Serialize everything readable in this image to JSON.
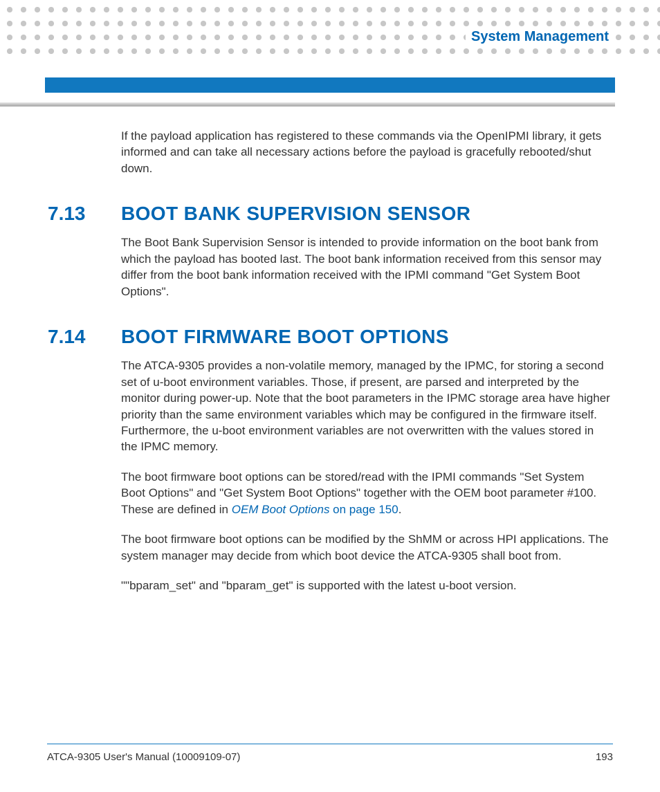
{
  "header": {
    "chapter": "System Management"
  },
  "intro_paragraph": "If the payload application has registered to these commands via the OpenIPMI library, it gets informed and can take all necessary actions before the payload is gracefully rebooted/shut down.",
  "section_713": {
    "number": "7.13",
    "title": "BOOT BANK SUPERVISION SENSOR",
    "p1": "The Boot Bank Supervision Sensor is intended to provide information on the boot bank from which the payload has booted last. The boot bank information received from this sensor may differ from the boot bank information received with the IPMI command \"Get System Boot Options\"."
  },
  "section_714": {
    "number": "7.14",
    "title": "BOOT FIRMWARE BOOT OPTIONS",
    "p1": "The ATCA-9305 provides a non-volatile memory, managed by the IPMC, for storing a second set of u-boot environment variables. Those, if present, are parsed and interpreted by the monitor during power-up. Note that the boot parameters in the IPMC storage area have higher priority than the same environment variables which may be configured in the firmware itself. Furthermore, the u-boot environment variables are not overwritten with the values stored in the IPMC memory.",
    "p2_pre": "The boot firmware boot options can be stored/read with the IPMI commands \"Set System Boot Options\" and \"Get System Boot Options\" together with the OEM boot parameter #100. These are defined in ",
    "p2_link": "OEM Boot Options",
    "p2_link_tail": " on page 150",
    "p2_post": ".",
    "p3": "The boot firmware boot options can be modified by the ShMM or across HPI applications. The system manager may decide from which boot device the ATCA-9305 shall boot from.",
    "p4": "\"\"bparam_set\" and \"bparam_get\" is supported with the latest u-boot version."
  },
  "footer": {
    "left": "ATCA-9305 User's Manual (10009109-07)",
    "right": "193"
  }
}
